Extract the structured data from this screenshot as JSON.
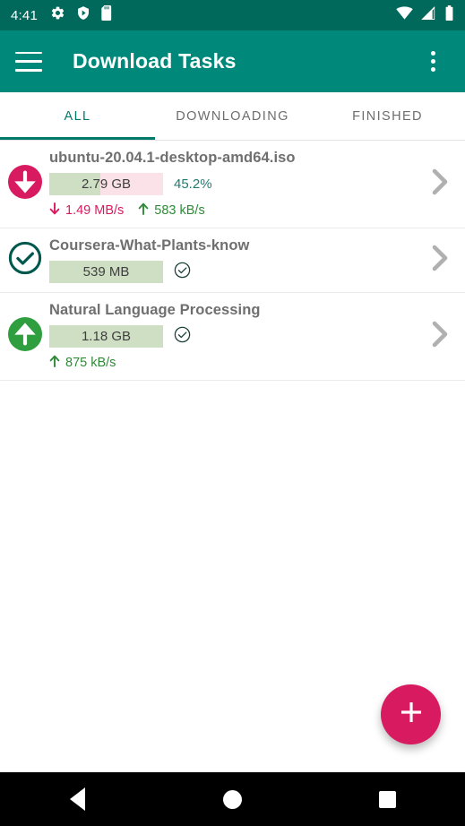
{
  "statusbar": {
    "time": "4:41",
    "left_icons": [
      "gear-icon",
      "shield-play-icon",
      "sd-card-icon"
    ],
    "right_icons": [
      "wifi-icon",
      "cell-signal-icon",
      "battery-icon"
    ],
    "background": "#00695c"
  },
  "appbar": {
    "title": "Download Tasks",
    "menu_icon": "hamburger-icon",
    "overflow_icon": "overflow-menu-icon",
    "background": "#00897b"
  },
  "tabs": {
    "items": [
      {
        "label": "ALL",
        "active": true
      },
      {
        "label": "DOWNLOADING",
        "active": false
      },
      {
        "label": "FINISHED",
        "active": false
      }
    ],
    "active_color": "#00796b",
    "inactive_color": "#6d6d6d"
  },
  "tasks": [
    {
      "status_icon": "download-circle-icon",
      "status_icon_color": "#d81b60",
      "title": "ubuntu-20.04.1-desktop-amd64.iso",
      "size": "2.79 GB",
      "progress_percent": 45.2,
      "percent_label": "45.2%",
      "completed": false,
      "download_speed": "1.49 MB/s",
      "upload_speed": "583 kB/s"
    },
    {
      "status_icon": "check-circle-outline-icon",
      "status_icon_color": "#00574b",
      "title": "Coursera-What-Plants-know",
      "size": "539 MB",
      "progress_percent": 100,
      "percent_label": "",
      "completed": true,
      "download_speed": "",
      "upload_speed": ""
    },
    {
      "status_icon": "upload-circle-icon",
      "status_icon_color": "#2e9e3e",
      "title": "Natural Language Processing",
      "size": "1.18 GB",
      "progress_percent": 100,
      "percent_label": "",
      "completed": true,
      "download_speed": "",
      "upload_speed": "875 kB/s"
    }
  ],
  "fab": {
    "icon": "plus-icon",
    "color": "#d81b60"
  },
  "navbar": {
    "back": "back-icon",
    "home": "home-icon",
    "recents": "recents-icon"
  },
  "colors": {
    "progress_done": "#cfdfc4",
    "progress_remaining": "#fbe2e8",
    "download_speed": "#d81b60",
    "upload_speed": "#2e8b37",
    "percent": "#26796f",
    "title": "#6f6f6f"
  }
}
